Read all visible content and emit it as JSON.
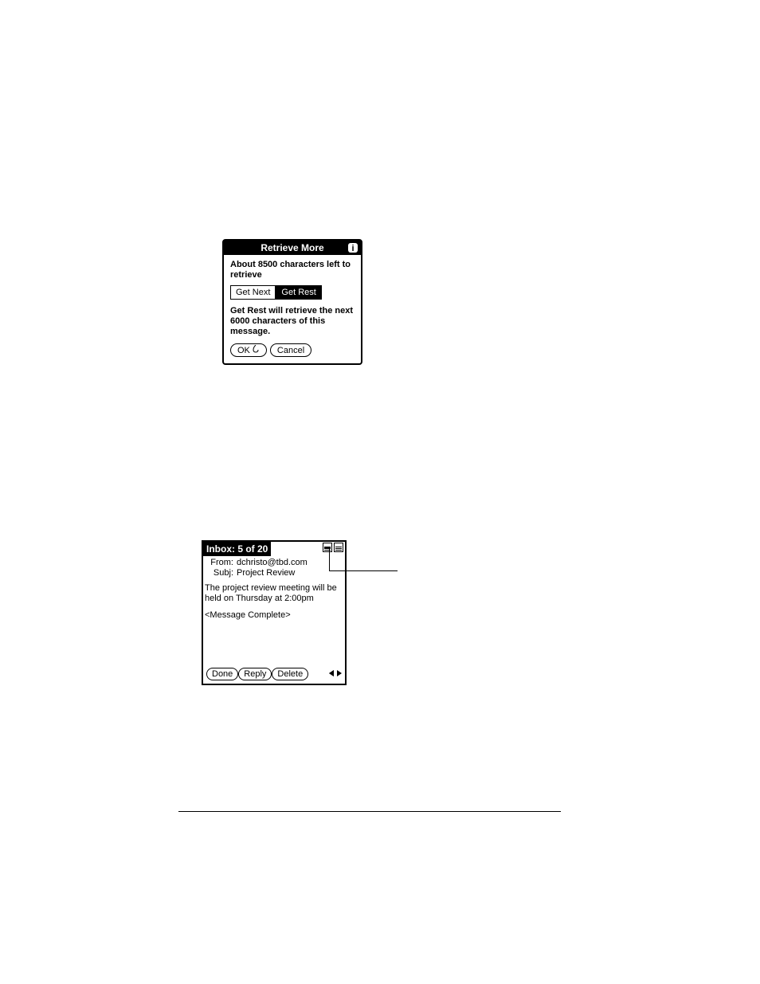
{
  "dialog": {
    "title": "Retrieve More",
    "chars_left": "About 8500 characters left to retrieve",
    "get_next_label": "Get Next",
    "get_rest_label": "Get Rest",
    "hint": "Get Rest will retrieve the next 6000 characters of this message.",
    "ok_label": "OK",
    "cancel_label": "Cancel"
  },
  "message": {
    "title": "Inbox: 5 of 20",
    "from_label": "From:",
    "from_value": "dchristo@tbd.com",
    "subj_label": "Subj:",
    "subj_value": "Project Review",
    "body": "The project review meeting will be held on Thursday at 2:00pm",
    "complete": "<Message Complete>",
    "done_label": "Done",
    "reply_label": "Reply",
    "delete_label": "Delete"
  }
}
